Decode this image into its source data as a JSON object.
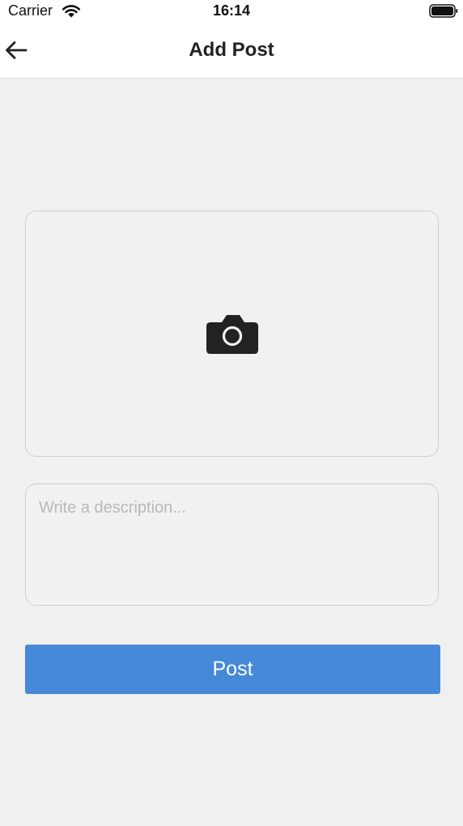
{
  "status_bar": {
    "carrier": "Carrier",
    "time": "16:14",
    "wifi_icon": "wifi-icon",
    "battery_icon": "battery-full-icon"
  },
  "nav": {
    "title": "Add Post",
    "back_icon": "arrow-left-icon"
  },
  "photo_picker": {
    "icon": "camera-icon"
  },
  "description": {
    "value": "",
    "placeholder": "Write a description..."
  },
  "post_button": {
    "label": "Post"
  },
  "colors": {
    "background": "#f0f0f0",
    "header": "#ffffff",
    "button": "#4589d8",
    "button_text": "#ffffff",
    "border": "#cfcfcf",
    "placeholder": "#b8b8b8"
  }
}
